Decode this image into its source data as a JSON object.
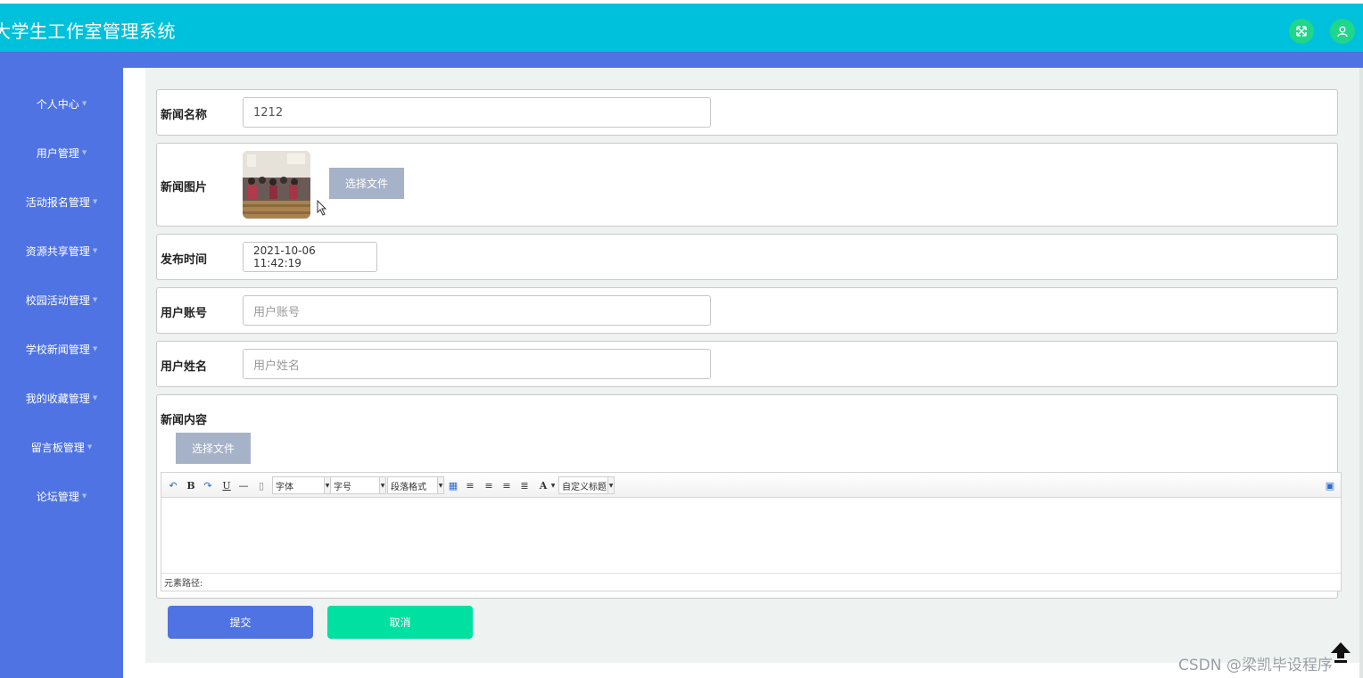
{
  "header": {
    "title": "大学生工作室管理系统"
  },
  "sidebar": {
    "items": [
      {
        "label": "个人中心"
      },
      {
        "label": "用户管理"
      },
      {
        "label": "活动报名管理"
      },
      {
        "label": "资源共享管理"
      },
      {
        "label": "校园活动管理"
      },
      {
        "label": "学校新闻管理"
      },
      {
        "label": "我的收藏管理"
      },
      {
        "label": "留言板管理"
      },
      {
        "label": "论坛管理"
      }
    ]
  },
  "form": {
    "news_name": {
      "label": "新闻名称",
      "value": "1212"
    },
    "news_image": {
      "label": "新闻图片",
      "file_button": "选择文件"
    },
    "publish_time": {
      "label": "发布时间",
      "value": "2021-10-06 11:42:19"
    },
    "user_account": {
      "label": "用户账号",
      "placeholder": "用户账号"
    },
    "user_name": {
      "label": "用户姓名",
      "placeholder": "用户姓名"
    },
    "news_content": {
      "label": "新闻内容",
      "file_button": "选择文件",
      "toolbar": {
        "bold": "B",
        "underline": "U",
        "font_family": "字体",
        "font_size": "字号",
        "paragraph": "段落格式",
        "font_color": "A",
        "custom_title": "自定义标题"
      },
      "status_path": "元素路径:"
    },
    "submit_label": "提交",
    "cancel_label": "取消"
  },
  "watermark": "CSDN @梁凯毕设程序",
  "colors": {
    "header": "#00c1dc",
    "sidebar": "#4f73e3",
    "submit": "#4f73e3",
    "cancel": "#00e0a0",
    "header_buttons": "#1fd68a"
  }
}
